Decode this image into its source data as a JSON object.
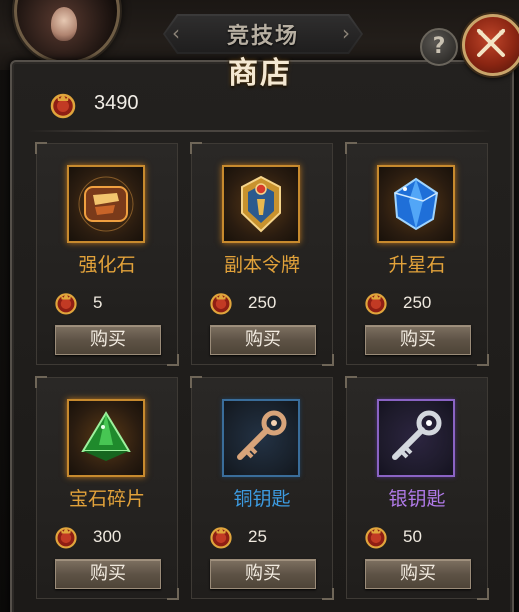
{
  "header": {
    "arena_title": "竞技场",
    "shop_title": "商店",
    "help_label": "?"
  },
  "currency": {
    "icon": "medal-coin-icon",
    "amount": "3490"
  },
  "colors": {
    "rarity_orange": "#e2a23a",
    "rarity_blue": "#3d9be0",
    "rarity_purple": "#b07ae8",
    "frame_orange": "#c78a2e"
  },
  "items": [
    {
      "name": "强化石",
      "price": "5",
      "buy_label": "购买",
      "icon": "enhance-stone-icon",
      "rarity": "orange"
    },
    {
      "name": "副本令牌",
      "price": "250",
      "buy_label": "购买",
      "icon": "dungeon-token-icon",
      "rarity": "orange"
    },
    {
      "name": "升星石",
      "price": "250",
      "buy_label": "购买",
      "icon": "star-up-stone-icon",
      "rarity": "orange"
    },
    {
      "name": "宝石碎片",
      "price": "300",
      "buy_label": "购买",
      "icon": "gem-fragment-icon",
      "rarity": "orange"
    },
    {
      "name": "铜钥匙",
      "price": "25",
      "buy_label": "购买",
      "icon": "copper-key-icon",
      "rarity": "blue"
    },
    {
      "name": "银钥匙",
      "price": "50",
      "buy_label": "购买",
      "icon": "silver-key-icon",
      "rarity": "purple"
    }
  ]
}
